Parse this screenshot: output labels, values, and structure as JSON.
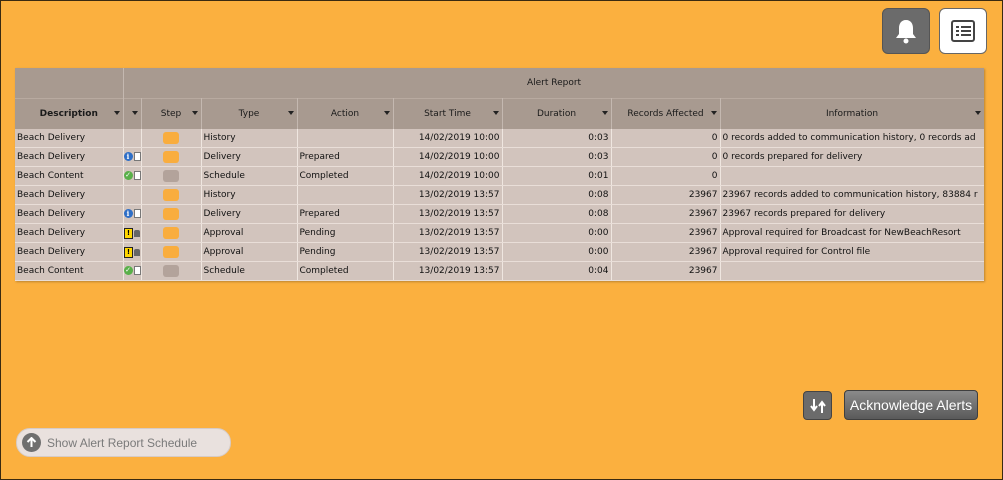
{
  "grid": {
    "title": "Alert Report",
    "columns": [
      {
        "key": "description",
        "label": "Description"
      },
      {
        "key": "flag",
        "label": ""
      },
      {
        "key": "step",
        "label": "Step"
      },
      {
        "key": "type",
        "label": "Type"
      },
      {
        "key": "action",
        "label": "Action"
      },
      {
        "key": "start",
        "label": "Start Time"
      },
      {
        "key": "duration",
        "label": "Duration"
      },
      {
        "key": "records",
        "label": "Records Affected"
      },
      {
        "key": "info",
        "label": "Information"
      }
    ],
    "rows": [
      {
        "description": "Beach Delivery",
        "icon": "none",
        "step": "orange",
        "type": "History",
        "action": "",
        "start": "14/02/2019 10:00",
        "duration": "0:03",
        "records": "0",
        "info": "0 records added to communication history, 0 records ad"
      },
      {
        "description": "Beach Delivery",
        "icon": "info",
        "step": "orange",
        "type": "Delivery",
        "action": "Prepared",
        "start": "14/02/2019 10:00",
        "duration": "0:03",
        "records": "0",
        "info": "0 records prepared for delivery"
      },
      {
        "description": "Beach Content",
        "icon": "check",
        "step": "grey",
        "type": "Schedule",
        "action": "Completed",
        "start": "14/02/2019 10:00",
        "duration": "0:01",
        "records": "0",
        "info": ""
      },
      {
        "description": "Beach Delivery",
        "icon": "none",
        "step": "orange",
        "type": "History",
        "action": "",
        "start": "13/02/2019 13:57",
        "duration": "0:08",
        "records": "23967",
        "info": "23967 records added to communication history, 83884 r"
      },
      {
        "description": "Beach Delivery",
        "icon": "info",
        "step": "orange",
        "type": "Delivery",
        "action": "Prepared",
        "start": "13/02/2019 13:57",
        "duration": "0:08",
        "records": "23967",
        "info": "23967 records prepared for delivery"
      },
      {
        "description": "Beach Delivery",
        "icon": "warn",
        "step": "orange",
        "type": "Approval",
        "action": "Pending",
        "start": "13/02/2019 13:57",
        "duration": "0:00",
        "records": "23967",
        "info": "Approval required for Broadcast for NewBeachResort"
      },
      {
        "description": "Beach Delivery",
        "icon": "warn",
        "step": "orange",
        "type": "Approval",
        "action": "Pending",
        "start": "13/02/2019 13:57",
        "duration": "0:00",
        "records": "23967",
        "info": "Approval required for Control file"
      },
      {
        "description": "Beach Content",
        "icon": "check",
        "step": "grey",
        "type": "Schedule",
        "action": "Completed",
        "start": "13/02/2019 13:57",
        "duration": "0:04",
        "records": "23967",
        "info": ""
      }
    ]
  },
  "buttons": {
    "acknowledge": "Acknowledge Alerts",
    "schedule": "Show Alert Report Schedule"
  },
  "icons": {
    "bell": "bell-icon",
    "report": "report-list-icon",
    "refresh": "refresh-icon",
    "up": "arrow-up-circle-icon"
  },
  "colors": {
    "background": "#fbb03f",
    "header": "#a89a90",
    "row": "#d2c4bd",
    "step_orange": "#f9ad3e",
    "step_grey": "#b3a39b"
  }
}
